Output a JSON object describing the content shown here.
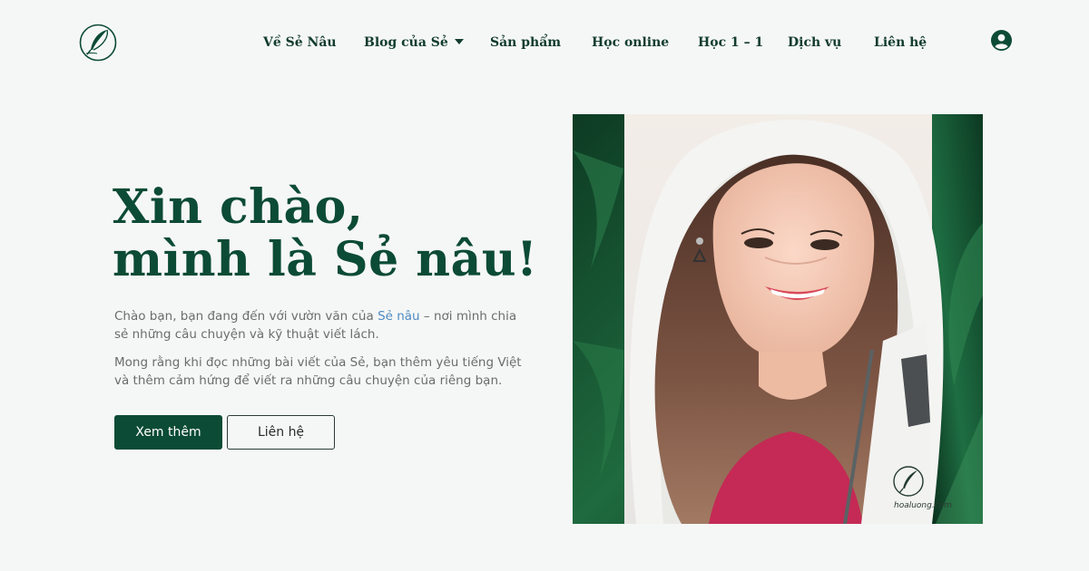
{
  "header": {
    "logo_icon": "feather-quill-icon",
    "nav": [
      {
        "label": "Về Sẻ Nâu"
      },
      {
        "label": "Blog của Sẻ",
        "has_dropdown": true
      },
      {
        "label": "Sản phẩm"
      },
      {
        "label": "Học online"
      },
      {
        "label": "Học 1 – 1"
      },
      {
        "label": "Dịch vụ"
      },
      {
        "label": "Liên hệ"
      }
    ],
    "account_icon": "user-circle-icon"
  },
  "hero": {
    "title_line1": "Xin chào,",
    "title_line2": "mình là Sẻ nâu!",
    "p1_before": "Chào bạn, bạn đang đến với vườn văn của ",
    "p1_link": "Sẻ nâu",
    "p1_after": " – nơi mình chia sẻ những câu chuyện và kỹ thuật viết lách.",
    "p2": "Mong rằng khi đọc những bài viết của Sẻ, bạn thêm yêu tiếng Việt và thêm cảm hứng để viết ra những câu chuyện của riêng bạn.",
    "primary_button": "Xem thêm",
    "secondary_button": "Liên hệ"
  },
  "photo": {
    "watermark_text": "hoaluong.com"
  },
  "colors": {
    "brand_green": "#0c4b35",
    "background": "#f5f7f6",
    "link_blue": "#4d8ac2"
  }
}
